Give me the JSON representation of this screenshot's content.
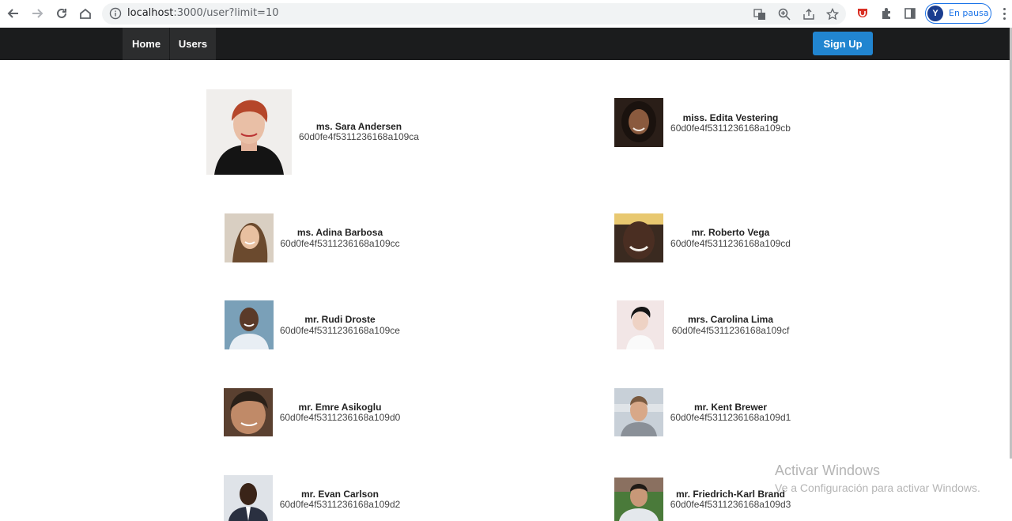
{
  "browser": {
    "url_host": "localhost",
    "url_path": ":3000/user?limit=10",
    "profile_initial": "Y",
    "profile_status": "En pausa"
  },
  "nav": {
    "home": "Home",
    "users": "Users",
    "signup": "Sign Up"
  },
  "users": [
    {
      "name": "ms. Sara Andersen",
      "id": "60d0fe4f5311236168a109ca"
    },
    {
      "name": "miss. Edita Vestering",
      "id": "60d0fe4f5311236168a109cb"
    },
    {
      "name": "ms. Adina Barbosa",
      "id": "60d0fe4f5311236168a109cc"
    },
    {
      "name": "mr. Roberto Vega",
      "id": "60d0fe4f5311236168a109cd"
    },
    {
      "name": "mr. Rudi Droste",
      "id": "60d0fe4f5311236168a109ce"
    },
    {
      "name": "mrs. Carolina Lima",
      "id": "60d0fe4f5311236168a109cf"
    },
    {
      "name": "mr. Emre Asikoglu",
      "id": "60d0fe4f5311236168a109d0"
    },
    {
      "name": "mr. Kent Brewer",
      "id": "60d0fe4f5311236168a109d1"
    },
    {
      "name": "mr. Evan Carlson",
      "id": "60d0fe4f5311236168a109d2"
    },
    {
      "name": "mr. Friedrich-Karl Brand",
      "id": "60d0fe4f5311236168a109d3"
    }
  ],
  "watermark": {
    "title": "Activar Windows",
    "subtitle": "Ve a Configuración para activar Windows."
  },
  "colors": {
    "navbar": "#1b1c1d",
    "nav_item": "#2c2d2e",
    "signup": "#2185d0"
  }
}
